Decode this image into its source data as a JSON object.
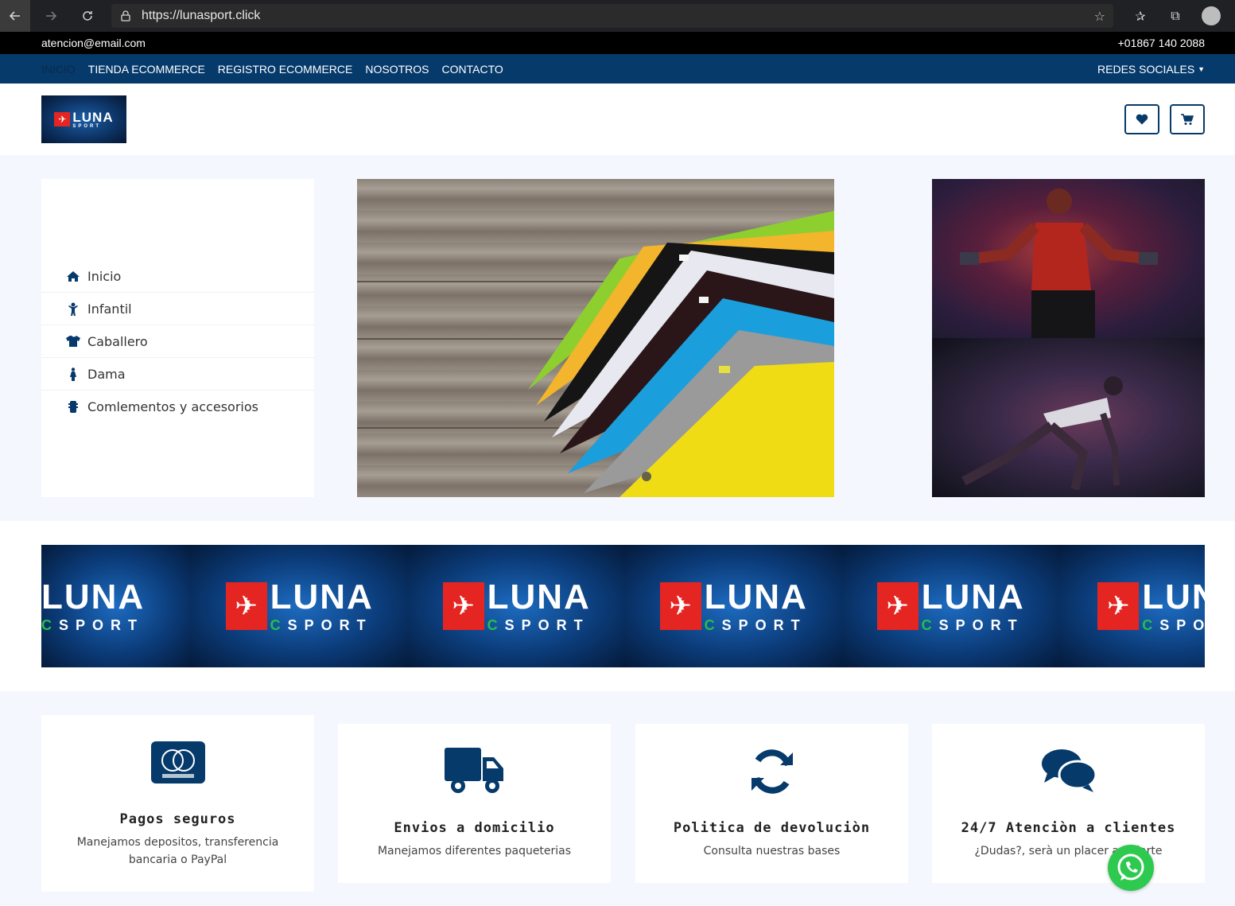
{
  "browser": {
    "url": "https://lunasport.click",
    "back_icon": "arrow-left-icon",
    "forward_icon": "arrow-right-icon",
    "refresh_icon": "refresh-icon"
  },
  "topbar": {
    "email": "atencion@email.com",
    "phone": "+01867 140 2088"
  },
  "nav": {
    "items": [
      "INICIO",
      "TIENDA ECOMMERCE",
      "REGISTRO ECOMMERCE",
      "NOSOTROS",
      "CONTACTO"
    ],
    "social": "REDES SOCIALES"
  },
  "logo": {
    "word": "LUNA",
    "sub": "SPORT"
  },
  "sidebar": {
    "items": [
      {
        "label": "Inicio",
        "icon": "home-icon"
      },
      {
        "label": "Infantil",
        "icon": "child-icon"
      },
      {
        "label": "Caballero",
        "icon": "tshirt-icon"
      },
      {
        "label": "Dama",
        "icon": "female-icon"
      },
      {
        "label": "Comlementos y accesorios",
        "icon": "accessory-icon"
      }
    ]
  },
  "banner": {
    "word": "LUNA",
    "sub": "SPORT"
  },
  "features": [
    {
      "title": "Pagos seguros",
      "desc": "Manejamos depositos, transferencia bancaria o PayPal",
      "icon": "mastercard-icon"
    },
    {
      "title": "Envios a domicilio",
      "desc": "Manejamos diferentes paqueterias",
      "icon": "truck-icon"
    },
    {
      "title": "Politica de devoluciòn",
      "desc": "Consulta nuestras bases",
      "icon": "sync-icon"
    },
    {
      "title": "24/7 Atenciòn a clientes",
      "desc": "¿Dudas?, serà un placer ayudarte",
      "icon": "chat-icon"
    }
  ],
  "colors": {
    "nav_bg": "#063a6b",
    "topbar_bg": "#000000",
    "accent_red": "#e52521",
    "whatsapp": "#2ec94f"
  }
}
